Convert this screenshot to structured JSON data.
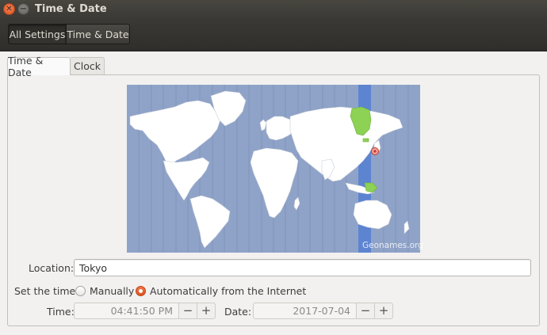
{
  "window": {
    "title": "Time & Date"
  },
  "toolbar": {
    "all_settings": "All Settings",
    "current": "Time & Date"
  },
  "tabs": [
    {
      "label": "Time & Date"
    },
    {
      "label": "Clock"
    }
  ],
  "map": {
    "attribution": "Geonames.org"
  },
  "location": {
    "label": "Location:",
    "value": "Tokyo"
  },
  "set_time": {
    "label": "Set the time:",
    "options": [
      {
        "label": "Manually",
        "selected": false
      },
      {
        "label": "Automatically from the Internet",
        "selected": true
      }
    ]
  },
  "time": {
    "label": "Time:",
    "value": "04:41:50 PM",
    "minus": "−",
    "plus": "+"
  },
  "date": {
    "label": "Date:",
    "value": "2017-07-04",
    "minus": "−",
    "plus": "+"
  },
  "colors": {
    "accent": "#e95420",
    "map_ocean": "#8fa3c8",
    "tz_highlight": "#5d84d1",
    "region_highlight": "#8dd155"
  }
}
